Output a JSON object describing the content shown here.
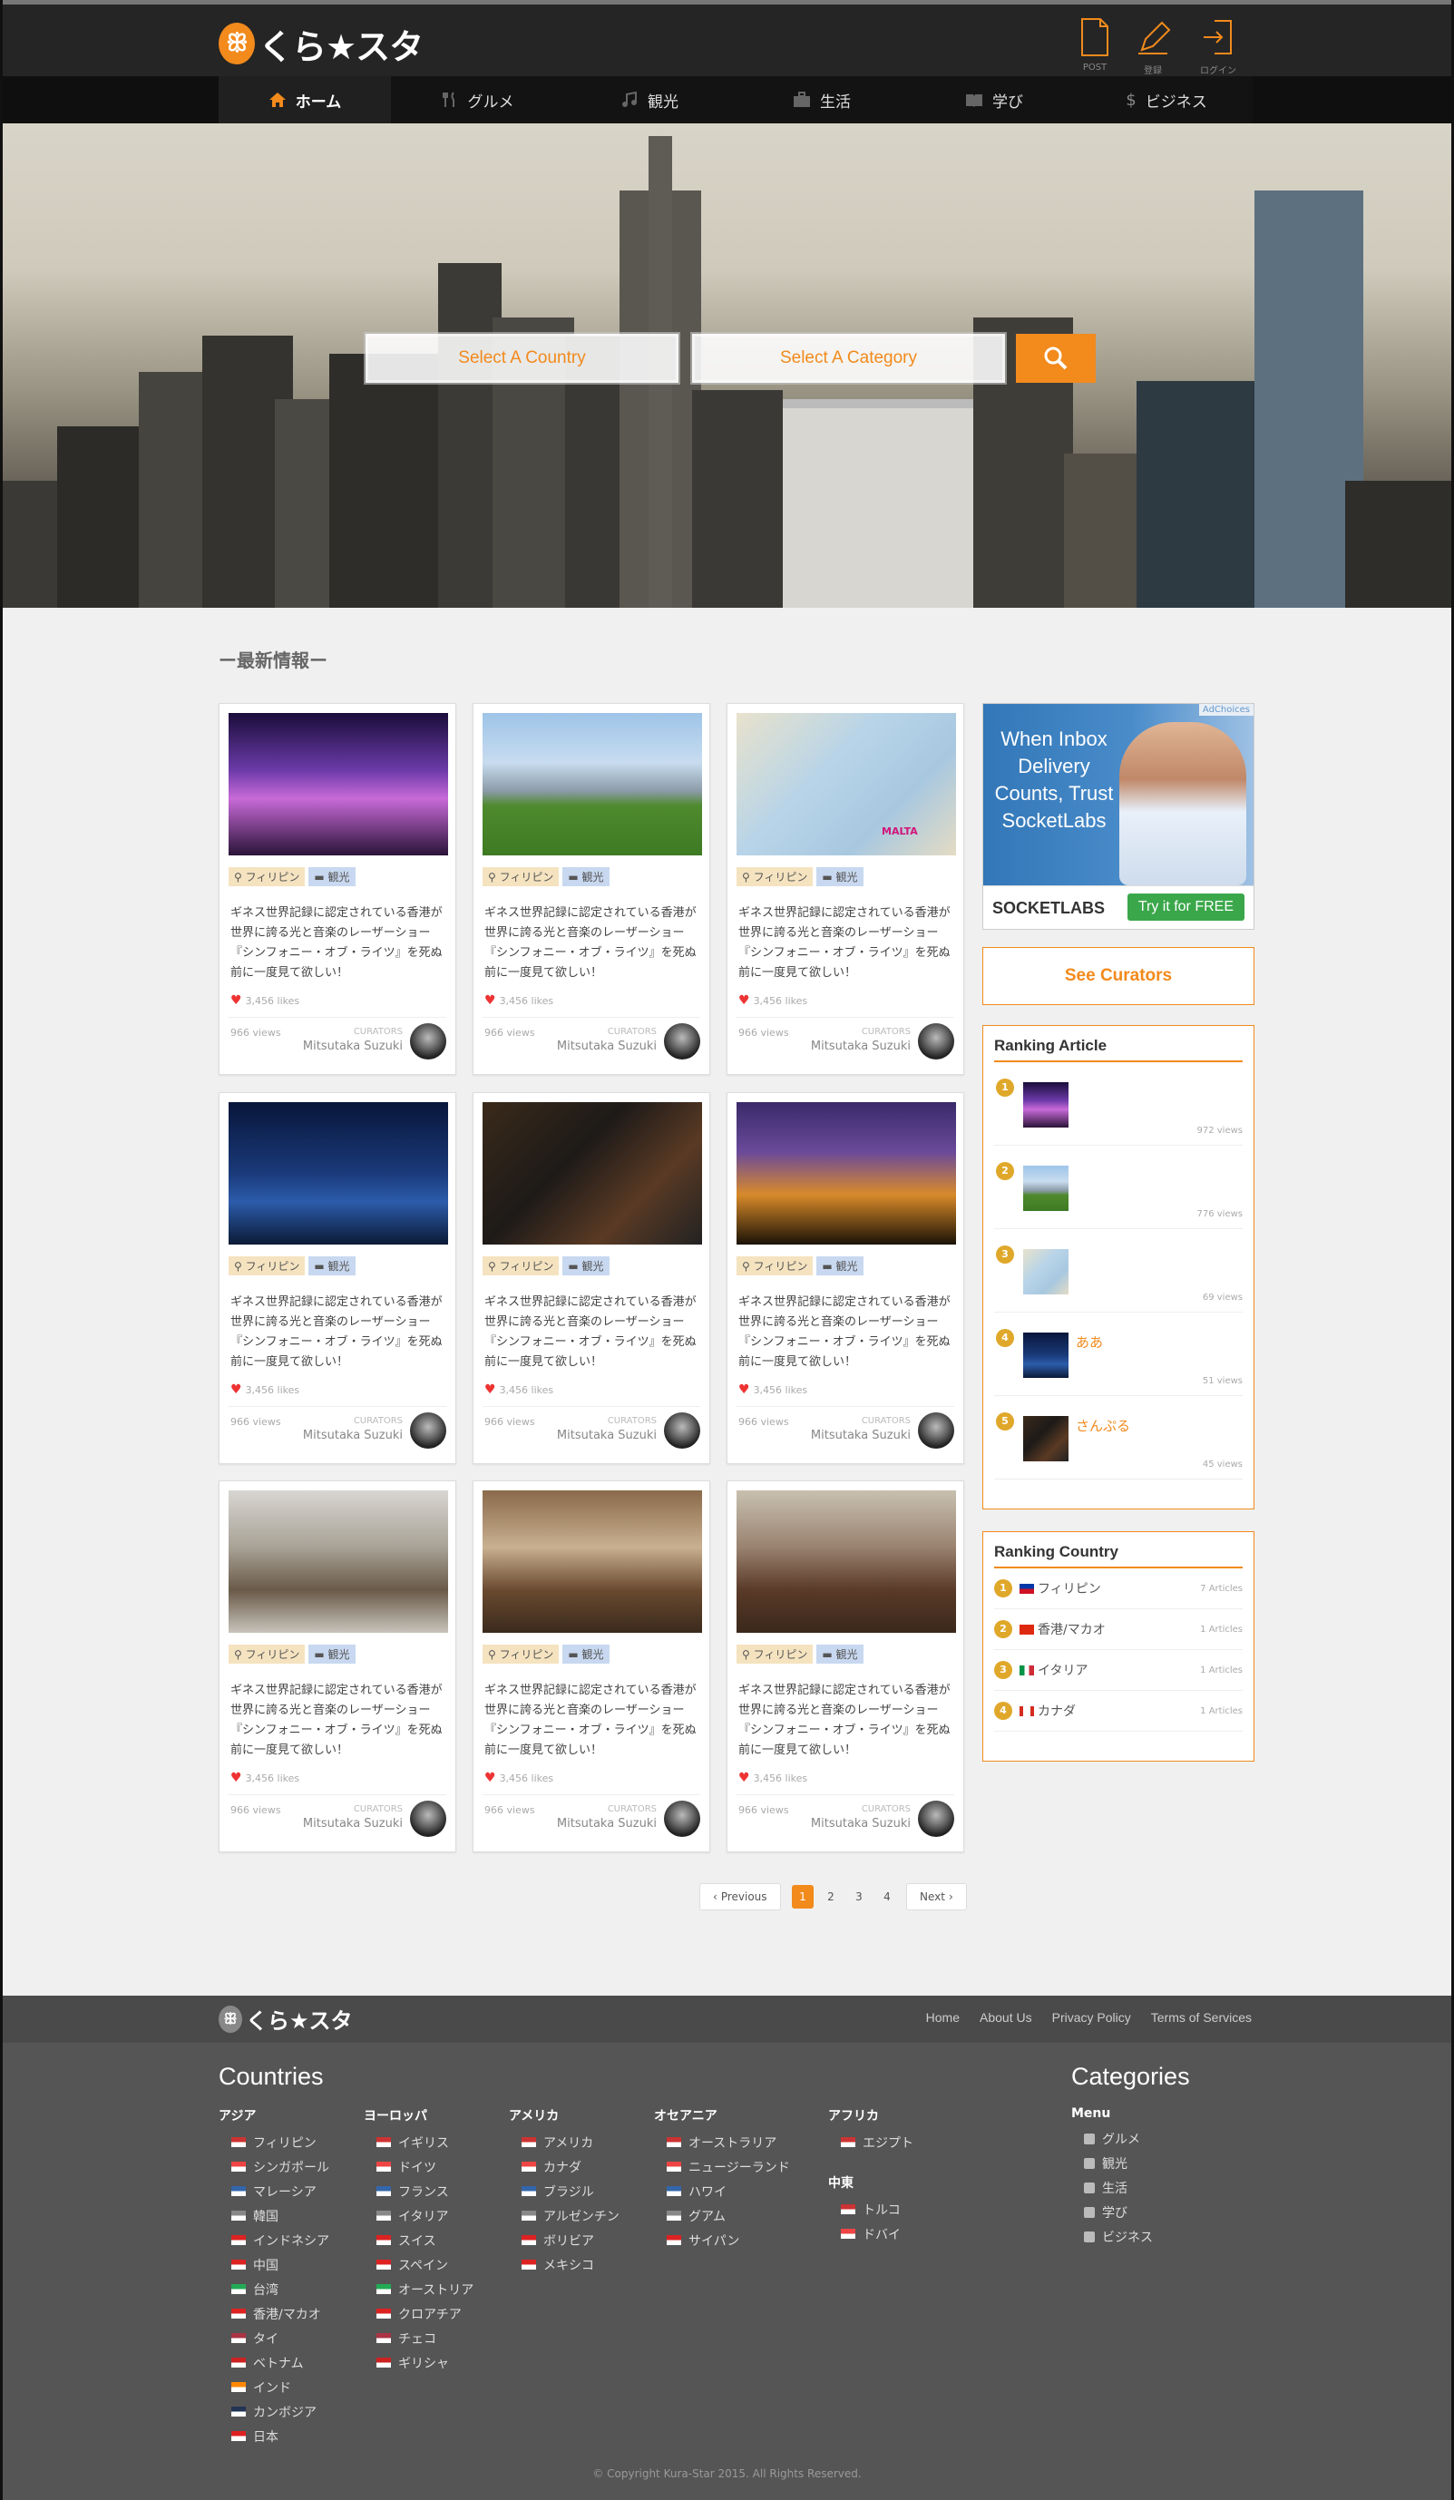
{
  "header": {
    "logo": "くら★スタ",
    "post_label": "POST",
    "register_label": "登録",
    "login_label": "ログイン"
  },
  "nav": [
    {
      "label": "ホーム",
      "icon": "home-icon"
    },
    {
      "label": "グルメ",
      "icon": "fork-knife-icon"
    },
    {
      "label": "観光",
      "icon": "music-note-icon"
    },
    {
      "label": "生活",
      "icon": "briefcase-icon"
    },
    {
      "label": "学び",
      "icon": "book-icon"
    },
    {
      "label": "ビジネス",
      "icon": "dollar-icon"
    }
  ],
  "search": {
    "country_label": "Select A Country",
    "category_label": "Select A Category"
  },
  "section_title": "ー最新情報ー",
  "articles": [
    {
      "country": "フィリピン",
      "category": "観光",
      "desc": "ギネス世界記録に認定されている香港が世界に誇る光と音楽のレーザーショー『シンフォニー・オブ・ライツ』を死ぬ前に一度見て欲しい！",
      "likes": "3,456 likes",
      "views": "966 views",
      "curators": "CURATORS",
      "author": "Mitsutaka Suzuki"
    },
    {
      "country": "フィリピン",
      "category": "観光",
      "desc": "ギネス世界記録に認定されている香港が世界に誇る光と音楽のレーザーショー『シンフォニー・オブ・ライツ』を死ぬ前に一度見て欲しい！",
      "likes": "3,456 likes",
      "views": "966 views",
      "curators": "CURATORS",
      "author": "Mitsutaka Suzuki"
    },
    {
      "country": "フィリピン",
      "category": "観光",
      "desc": "ギネス世界記録に認定されている香港が世界に誇る光と音楽のレーザーショー『シンフォニー・オブ・ライツ』を死ぬ前に一度見て欲しい！",
      "likes": "3,456 likes",
      "views": "966 views",
      "curators": "CURATORS",
      "author": "Mitsutaka Suzuki",
      "map_label": "MALTA"
    },
    {
      "country": "フィリピン",
      "category": "観光",
      "desc": "ギネス世界記録に認定されている香港が世界に誇る光と音楽のレーザーショー『シンフォニー・オブ・ライツ』を死ぬ前に一度見て欲しい！",
      "likes": "3,456 likes",
      "views": "966 views",
      "curators": "CURATORS",
      "author": "Mitsutaka Suzuki"
    },
    {
      "country": "フィリピン",
      "category": "観光",
      "desc": "ギネス世界記録に認定されている香港が世界に誇る光と音楽のレーザーショー『シンフォニー・オブ・ライツ』を死ぬ前に一度見て欲しい！",
      "likes": "3,456 likes",
      "views": "966 views",
      "curators": "CURATORS",
      "author": "Mitsutaka Suzuki"
    },
    {
      "country": "フィリピン",
      "category": "観光",
      "desc": "ギネス世界記録に認定されている香港が世界に誇る光と音楽のレーザーショー『シンフォニー・オブ・ライツ』を死ぬ前に一度見て欲しい！",
      "likes": "3,456 likes",
      "views": "966 views",
      "curators": "CURATORS",
      "author": "Mitsutaka Suzuki"
    },
    {
      "country": "フィリピン",
      "category": "観光",
      "desc": "ギネス世界記録に認定されている香港が世界に誇る光と音楽のレーザーショー『シンフォニー・オブ・ライツ』を死ぬ前に一度見て欲しい！",
      "likes": "3,456 likes",
      "views": "966 views",
      "curators": "CURATORS",
      "author": "Mitsutaka Suzuki"
    },
    {
      "country": "フィリピン",
      "category": "観光",
      "desc": "ギネス世界記録に認定されている香港が世界に誇る光と音楽のレーザーショー『シンフォニー・オブ・ライツ』を死ぬ前に一度見て欲しい！",
      "likes": "3,456 likes",
      "views": "966 views",
      "curators": "CURATORS",
      "author": "Mitsutaka Suzuki"
    },
    {
      "country": "フィリピン",
      "category": "観光",
      "desc": "ギネス世界記録に認定されている香港が世界に誇る光と音楽のレーザーショー『シンフォニー・オブ・ライツ』を死ぬ前に一度見て欲しい！",
      "likes": "3,456 likes",
      "views": "966 views",
      "curators": "CURATORS",
      "author": "Mitsutaka Suzuki"
    }
  ],
  "ad": {
    "choices": "AdChoices",
    "headline": "When Inbox Delivery Counts, Trust SocketLabs",
    "brand": "SOCKETLABS",
    "cta": "Try it for FREE"
  },
  "sidebar": {
    "see_curators": "See Curators",
    "ranking_article_title": "Ranking Article",
    "ranking_articles": [
      {
        "num": "1",
        "title": "",
        "views": "972 views"
      },
      {
        "num": "2",
        "title": "",
        "views": "776 views"
      },
      {
        "num": "3",
        "title": "",
        "views": "69 views"
      },
      {
        "num": "4",
        "title": "ああ",
        "views": "51 views"
      },
      {
        "num": "5",
        "title": "さんぷる",
        "views": "45 views"
      }
    ],
    "ranking_country_title": "Ranking Country",
    "ranking_countries": [
      {
        "num": "1",
        "name": "フィリピン",
        "articles": "7 Articles",
        "flag": "ph"
      },
      {
        "num": "2",
        "name": "香港/マカオ",
        "articles": "1 Articles",
        "flag": "hk"
      },
      {
        "num": "3",
        "name": "イタリア",
        "articles": "1 Articles",
        "flag": "it"
      },
      {
        "num": "4",
        "name": "カナダ",
        "articles": "1 Articles",
        "flag": "ca"
      }
    ]
  },
  "pagination": {
    "prev": "Previous",
    "pages": [
      "1",
      "2",
      "3",
      "4"
    ],
    "current": "1",
    "next": "Next"
  },
  "footer": {
    "logo": "くら★スタ",
    "links": [
      "Home",
      "About Us",
      "Privacy Policy",
      "Terms of Services"
    ],
    "countries_title": "Countries",
    "categories_title": "Categories",
    "regions": [
      {
        "name": "アジア",
        "items": [
          "フィリピン",
          "シンガポール",
          "マレーシア",
          "韓国",
          "インドネシア",
          "中国",
          "台湾",
          "香港/マカオ",
          "タイ",
          "ベトナム",
          "インド",
          "カンボジア",
          "日本"
        ]
      },
      {
        "name": "ヨーロッパ",
        "items": [
          "イギリス",
          "ドイツ",
          "フランス",
          "イタリア",
          "スイス",
          "スペイン",
          "オーストリア",
          "クロアチア",
          "チェコ",
          "ギリシャ"
        ]
      },
      {
        "name": "アメリカ",
        "items": [
          "アメリカ",
          "カナダ",
          "ブラジル",
          "アルゼンチン",
          "ボリビア",
          "メキシコ"
        ]
      },
      {
        "name": "オセアニア",
        "items": [
          "オーストラリア",
          "ニュージーランド",
          "ハワイ",
          "グアム",
          "サイパン"
        ]
      },
      {
        "name": "アフリカ",
        "items": [
          "エジプト"
        ]
      },
      {
        "name": "中東",
        "items": [
          "トルコ",
          "ドバイ"
        ]
      }
    ],
    "menu_title": "Menu",
    "menu_items": [
      "グルメ",
      "観光",
      "生活",
      "学び",
      "ビジネス"
    ],
    "copyright": "© Copyright Kura-Star 2015. All Rights Reserved."
  }
}
